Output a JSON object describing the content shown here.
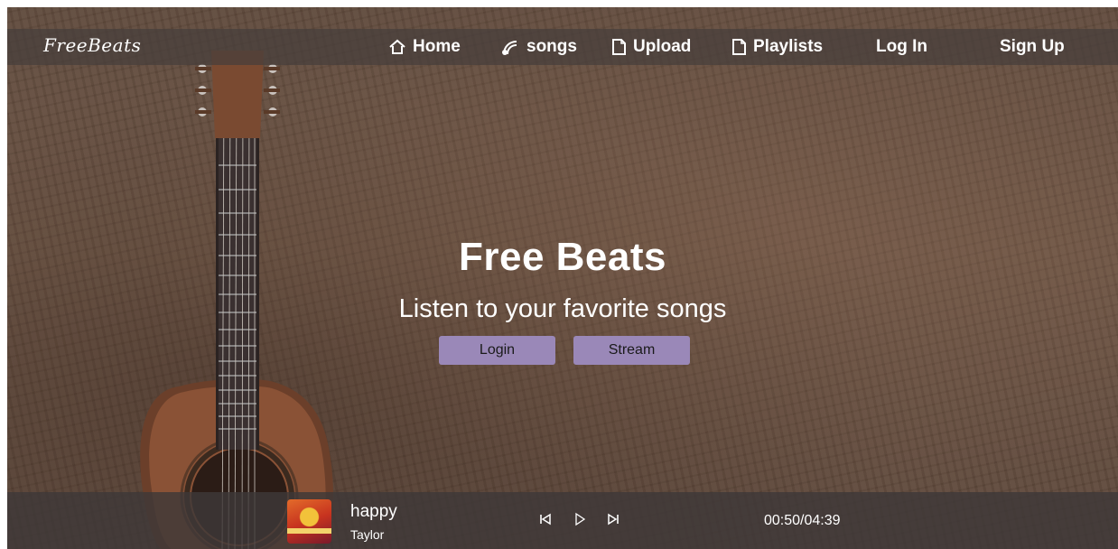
{
  "brand": {
    "logo": "FreeBeats"
  },
  "nav": {
    "items": [
      {
        "label": "Home",
        "icon": "home-icon"
      },
      {
        "label": "songs",
        "icon": "audio-waves-icon"
      },
      {
        "label": "Upload",
        "icon": "document-icon"
      },
      {
        "label": "Playlists",
        "icon": "document-icon"
      },
      {
        "label": "Log In",
        "icon": ""
      },
      {
        "label": "Sign Up",
        "icon": ""
      }
    ]
  },
  "hero": {
    "title": "Free Beats",
    "subtitle": "Listen to your favorite songs",
    "buttons": {
      "login": "Login",
      "stream": "Stream"
    }
  },
  "player": {
    "song": "happy",
    "artist": "Taylor",
    "time": "00:50/04:39",
    "controls": [
      "previous-icon",
      "play-icon",
      "next-icon"
    ]
  },
  "colors": {
    "nav_bg": "#463e3c",
    "button_bg": "#9a88b8",
    "text": "#ffffff"
  }
}
